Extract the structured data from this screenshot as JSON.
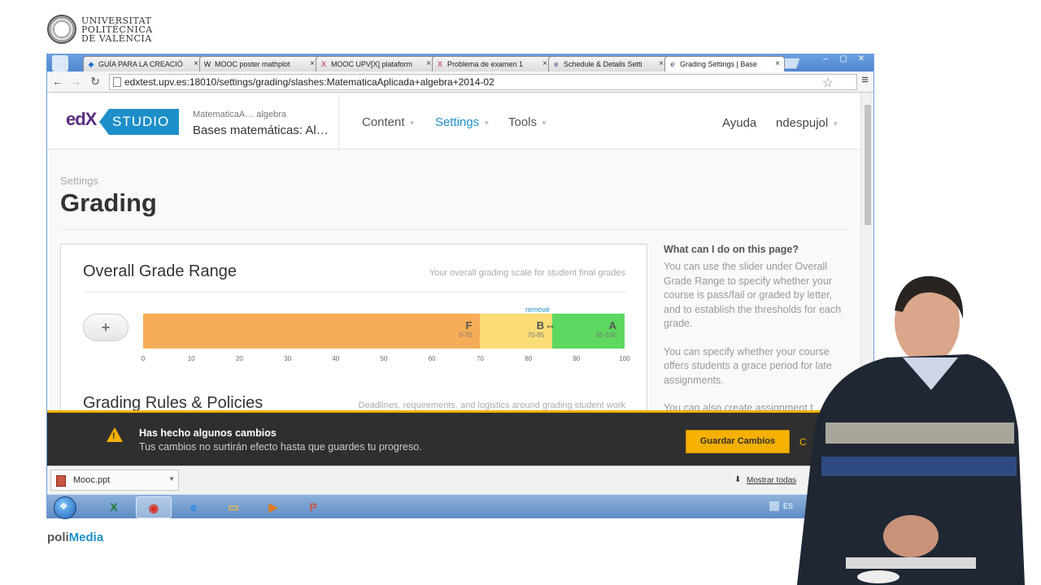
{
  "university": {
    "lines": [
      "UNIVERSITAT",
      "POLITÈCNICA",
      "DE VALÈNCIA"
    ]
  },
  "browser": {
    "tabs": [
      {
        "label": "GUÍA PARA LA CREACIÓ",
        "icon": "dropbox-icon",
        "active": false
      },
      {
        "label": "MOOC poster mathplot",
        "icon": "wikipedia-icon",
        "active": false
      },
      {
        "label": "MOOC UPV[X] plataform",
        "icon": "upvx-icon",
        "active": false
      },
      {
        "label": "Problema de examen 1",
        "icon": "upvx-icon",
        "active": false
      },
      {
        "label": "Schedule & Details Setti",
        "icon": "edx-icon",
        "active": false
      },
      {
        "label": "Grading Settings | Base",
        "icon": "edx-icon",
        "active": true
      }
    ],
    "url": "edxtest.upv.es:18010/settings/grading/slashes:MatematicaAplicada+algebra+2014-02",
    "window_controls": [
      "–",
      "▢",
      "✕"
    ]
  },
  "header": {
    "logo": "edX",
    "badge": "STUDIO",
    "course_org": "MatematicaA… algebra",
    "course_title": "Bases matemáticas: Al…",
    "nav": [
      {
        "label": "Content",
        "active": false
      },
      {
        "label": "Settings",
        "active": true
      },
      {
        "label": "Tools",
        "active": false
      }
    ],
    "help": "Ayuda",
    "user": "ndespujol"
  },
  "page": {
    "breadcrumb": "Settings",
    "title": "Grading"
  },
  "grade_range": {
    "title": "Overall Grade Range",
    "description": "Your overall grading scale for student final grades",
    "add_button": "+",
    "remove_label": "remove",
    "grades": [
      {
        "letter": "F",
        "range": "0-70",
        "from": 0,
        "to": 70,
        "color": "#f5ad57"
      },
      {
        "letter": "B",
        "range": "70-85",
        "from": 70,
        "to": 85,
        "color": "#fbdc77"
      },
      {
        "letter": "A",
        "range": "85-100",
        "from": 85,
        "to": 100,
        "color": "#5ed860"
      }
    ],
    "ticks": [
      "0",
      "10",
      "20",
      "30",
      "40",
      "50",
      "60",
      "70",
      "80",
      "90",
      "100"
    ]
  },
  "rules": {
    "title": "Grading Rules & Policies",
    "description": "Deadlines, requirements, and logistics around grading student work"
  },
  "help": {
    "heading": "What can I do on this page?",
    "paragraphs": [
      "You can use the slider under Overall Grade Range to specify whether your course is pass/fail or graded by letter, and to establish the thresholds for each grade.",
      "You can specify whether your course offers students a grace period for late assignments.",
      "You can also create assignment t"
    ]
  },
  "notification": {
    "title": "Has hecho algunos cambios",
    "message": "Tus cambios no surtirán efecto hasta que guardes tu progreso.",
    "save": "Guardar Cambios",
    "cancel": "C"
  },
  "downloads": {
    "file": "Mooc.ppt",
    "show_all": "Mostrar todas"
  },
  "taskbar": {
    "apps": [
      {
        "name": "excel-icon",
        "glyph": "X",
        "color": "#1e7b34",
        "active": false
      },
      {
        "name": "chrome-icon",
        "glyph": "◉",
        "color": "#d93025",
        "active": true
      },
      {
        "name": "ie-icon",
        "glyph": "e",
        "color": "#1e88e5",
        "active": false
      },
      {
        "name": "folder-icon",
        "glyph": "▭",
        "color": "#e8b84b",
        "active": false
      },
      {
        "name": "media-player-icon",
        "glyph": "▶",
        "color": "#e07a1e",
        "active": false
      },
      {
        "name": "powerpoint-icon",
        "glyph": "P",
        "color": "#c8553d",
        "active": false
      }
    ],
    "tray": "ES"
  },
  "branding": {
    "prefix": "poli",
    "suffix": "Media"
  },
  "colors": {
    "studio_blue": "#1d8fc8",
    "warning": "#f5b000",
    "edx_purple": "#5b2c83"
  }
}
